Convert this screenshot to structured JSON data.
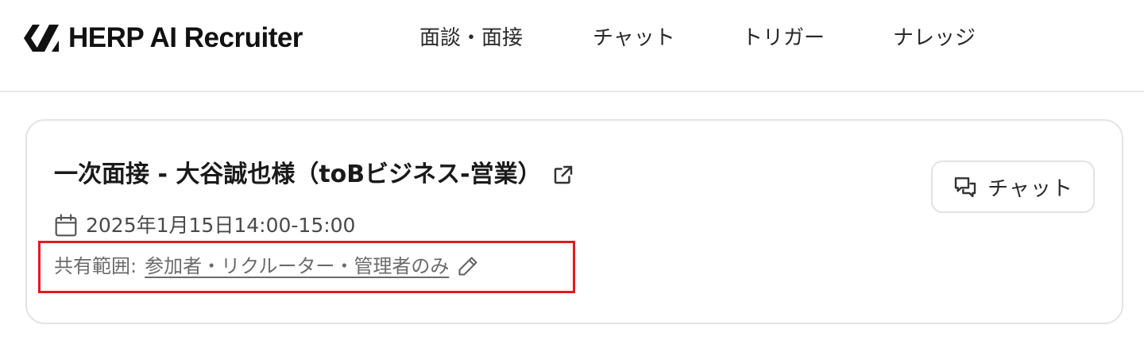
{
  "header": {
    "brand": "HERP AI Recruiter",
    "nav": [
      {
        "label": "面談・面接"
      },
      {
        "label": "チャット"
      },
      {
        "label": "トリガー"
      },
      {
        "label": "ナレッジ"
      }
    ]
  },
  "meeting": {
    "title": "一次面接 - 大谷誠也様（toBビジネス-営業）",
    "chat_button_label": "チャット",
    "datetime": "2025年1月15日14:00-15:00",
    "share_label": "共有範囲:",
    "share_value": "参加者・リクルーター・管理者のみ",
    "highlight_color": "#e31b1b"
  },
  "icons": {
    "logo": "herp-logo-icon",
    "external_link": "external-link-icon",
    "chat": "chat-bubbles-icon",
    "calendar": "calendar-icon",
    "edit": "pencil-icon"
  }
}
